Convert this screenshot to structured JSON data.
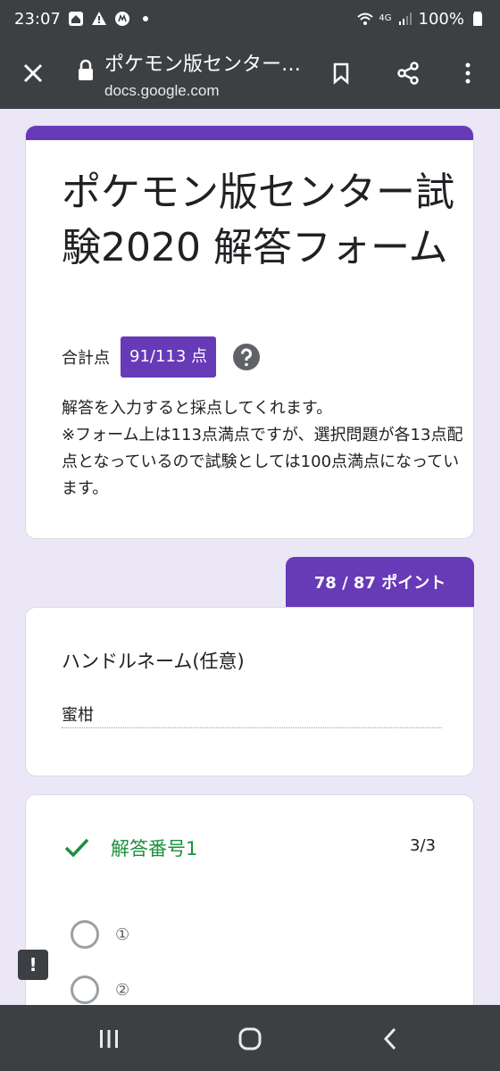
{
  "status_bar": {
    "time": "23:07",
    "network": "4G",
    "battery": "100%"
  },
  "browser": {
    "page_title": "ポケモン版センター試験2020 解答フォーム",
    "url": "docs.google.com"
  },
  "form": {
    "title": "ポケモン版センター試験2020 解答フォーム",
    "total_label": "合計点",
    "total_score": "91/113 点",
    "description": "解答を入力すると採点してくれます。\n※フォーム上は113点満点ですが、選択問題が各13点配点となっているので試験としては100点満点になっています。",
    "section_points": "78 / 87 ポイント"
  },
  "questions": [
    {
      "title": "ハンドルネーム(任意)",
      "answer": "蜜柑"
    },
    {
      "title": "解答番号1",
      "score": "3/3",
      "options": [
        "①",
        "②"
      ]
    }
  ],
  "feedback": {
    "label": "!"
  },
  "colors": {
    "accent": "#673ab7",
    "correct": "#1e8e3e",
    "bar": "#3c4043",
    "background": "#ece7f6"
  }
}
